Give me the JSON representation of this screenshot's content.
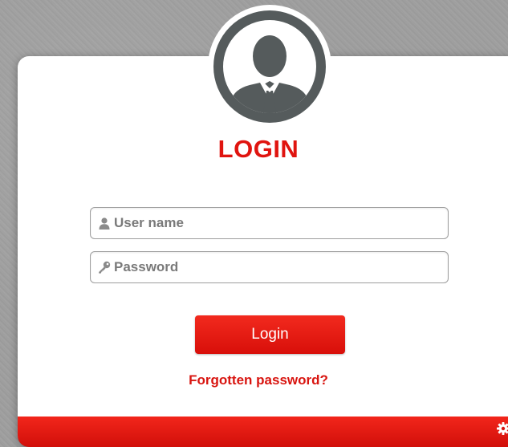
{
  "login": {
    "title": "LOGIN",
    "username_placeholder": "User name",
    "password_placeholder": "Password",
    "login_button": "Login",
    "forgot_link": "Forgotten password?"
  },
  "icons": {
    "avatar": "user-avatar-icon",
    "username": "user-icon",
    "password": "key-icon",
    "settings": "gear-icon"
  },
  "colors": {
    "accent": "#e0140f",
    "avatar": "#555b5c",
    "background": "#9f9f9f"
  }
}
